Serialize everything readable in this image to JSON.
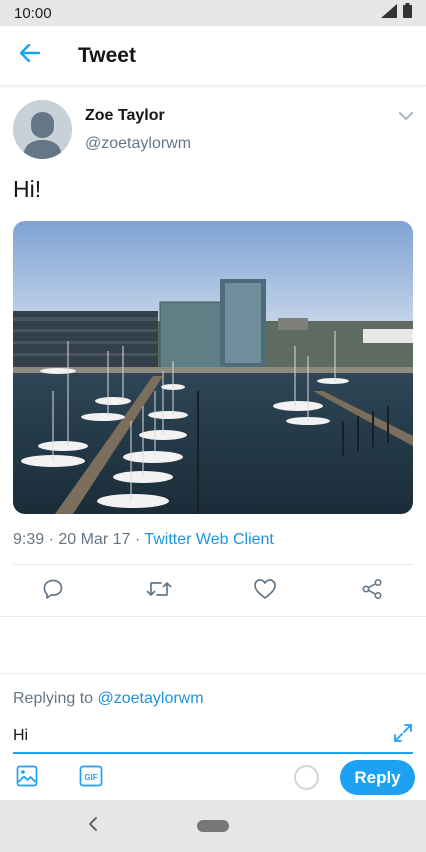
{
  "status_bar": {
    "time": "10:00",
    "icons": [
      "signal-icon",
      "battery-icon"
    ]
  },
  "app_bar": {
    "back_icon": "arrow-left-icon",
    "title": "Tweet"
  },
  "tweet": {
    "author_name": "Zoe Taylor",
    "author_handle": "@zoetaylorwm",
    "text": "Hi!",
    "time": "9:39",
    "date": "20 Mar 17",
    "separator": " · ",
    "client": "Twitter Web Client",
    "media_description": "harbor-with-sailboats-photo"
  },
  "actions": [
    "reply-icon",
    "retweet-icon",
    "like-icon",
    "share-icon"
  ],
  "composer": {
    "replying_prefix": "Replying to ",
    "replying_to": "@zoetaylorwm",
    "input_value": "Hi",
    "reply_label": "Reply"
  },
  "colors": {
    "accent": "#1da1f2",
    "link": "#1b95e0",
    "secondary_text": "#657786",
    "divider": "#e6ecf0"
  }
}
